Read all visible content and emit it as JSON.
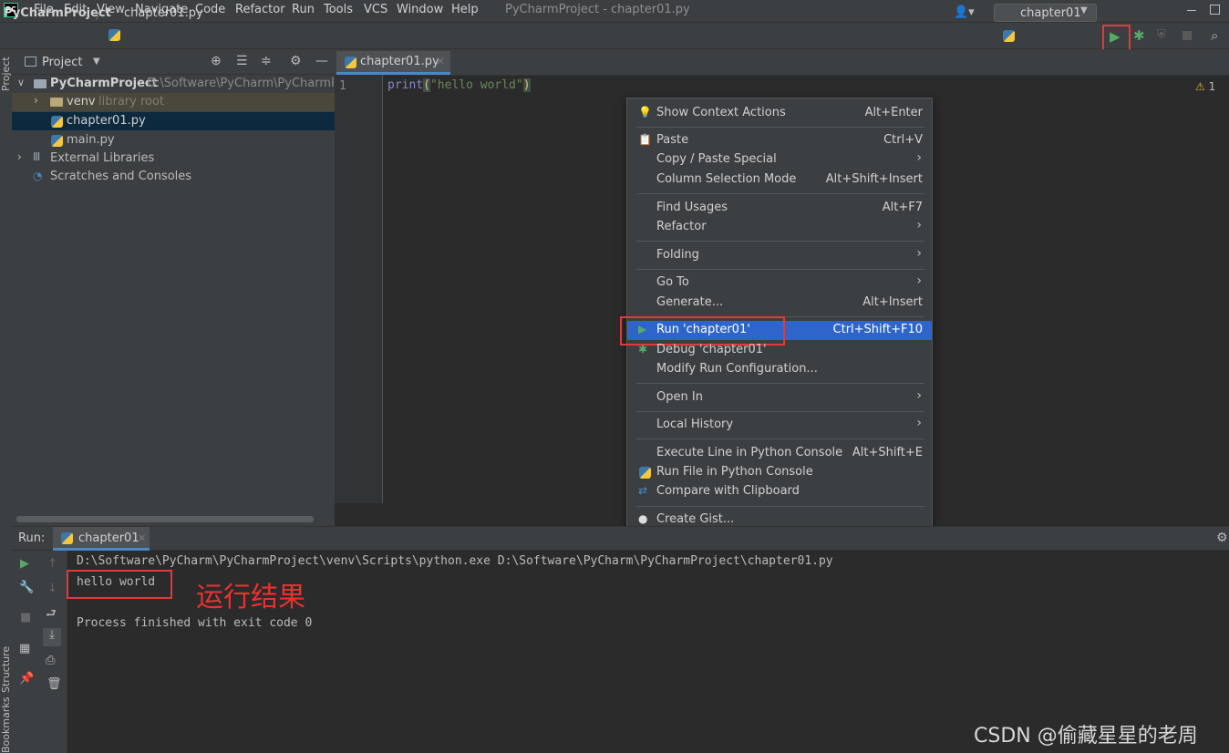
{
  "menubar": {
    "logo": "PC",
    "items": [
      "File",
      "Edit",
      "View",
      "Navigate",
      "Code",
      "Refactor",
      "Run",
      "Tools",
      "VCS",
      "Window",
      "Help"
    ],
    "window_title": "PyCharmProject - chapter01.py"
  },
  "navbar": {
    "project": "PyCharmProject",
    "separator": "〉",
    "file": "chapter01.py",
    "user_icon": "👤▾",
    "run_config": "chapter01"
  },
  "sidebar": {
    "project_stripe": "Project",
    "structure_stripe": "Structure",
    "bookmarks_stripe": "Bookmarks"
  },
  "project_panel": {
    "title": "Project",
    "tree": [
      {
        "label": "PyCharmProject",
        "hint": "D:\\Software\\PyCharm\\PyCharmProj"
      },
      {
        "label": "venv",
        "hint": "library root"
      },
      {
        "label": "chapter01.py"
      },
      {
        "label": "main.py"
      },
      {
        "label": "External Libraries"
      },
      {
        "label": "Scratches and Consoles"
      }
    ]
  },
  "editor": {
    "tab": "chapter01.py",
    "line_number": "1",
    "code_func": "print",
    "code_lparen": "(",
    "code_string": "\"hello world\"",
    "code_rparen": ")",
    "warning_count": "1"
  },
  "context_menu": {
    "items": [
      {
        "label": "Show Context Actions",
        "shortcut": "Alt+Enter"
      },
      {
        "label": "Paste",
        "shortcut": "Ctrl+V"
      },
      {
        "label": "Copy / Paste Special",
        "shortcut": ""
      },
      {
        "label": "Column Selection Mode",
        "shortcut": "Alt+Shift+Insert"
      },
      {
        "label": "Find Usages",
        "shortcut": "Alt+F7"
      },
      {
        "label": "Refactor",
        "shortcut": ""
      },
      {
        "label": "Folding",
        "shortcut": ""
      },
      {
        "label": "Go To",
        "shortcut": ""
      },
      {
        "label": "Generate...",
        "shortcut": "Alt+Insert"
      },
      {
        "label": "Run 'chapter01'",
        "shortcut": "Ctrl+Shift+F10"
      },
      {
        "label": "Debug 'chapter01'",
        "shortcut": ""
      },
      {
        "label": "Modify Run Configuration...",
        "shortcut": ""
      },
      {
        "label": "Open In",
        "shortcut": ""
      },
      {
        "label": "Local History",
        "shortcut": ""
      },
      {
        "label": "Execute Line in Python Console",
        "shortcut": "Alt+Shift+E"
      },
      {
        "label": "Run File in Python Console",
        "shortcut": ""
      },
      {
        "label": "Compare with Clipboard",
        "shortcut": ""
      },
      {
        "label": "Create Gist...",
        "shortcut": ""
      }
    ]
  },
  "run_panel": {
    "label": "Run:",
    "tab": "chapter01",
    "console": [
      "D:\\Software\\PyCharm\\PyCharmProject\\venv\\Scripts\\python.exe D:\\Software\\PyCharm\\PyCharmProject\\chapter01.py",
      "hello world",
      "Process finished with exit code 0"
    ],
    "annotation": "运行结果"
  },
  "watermark": "CSDN @偷藏星星的老周",
  "colors": {
    "highlight": "#2f65ca",
    "annotation_red": "#e03a3a",
    "run_green": "#59a869"
  }
}
